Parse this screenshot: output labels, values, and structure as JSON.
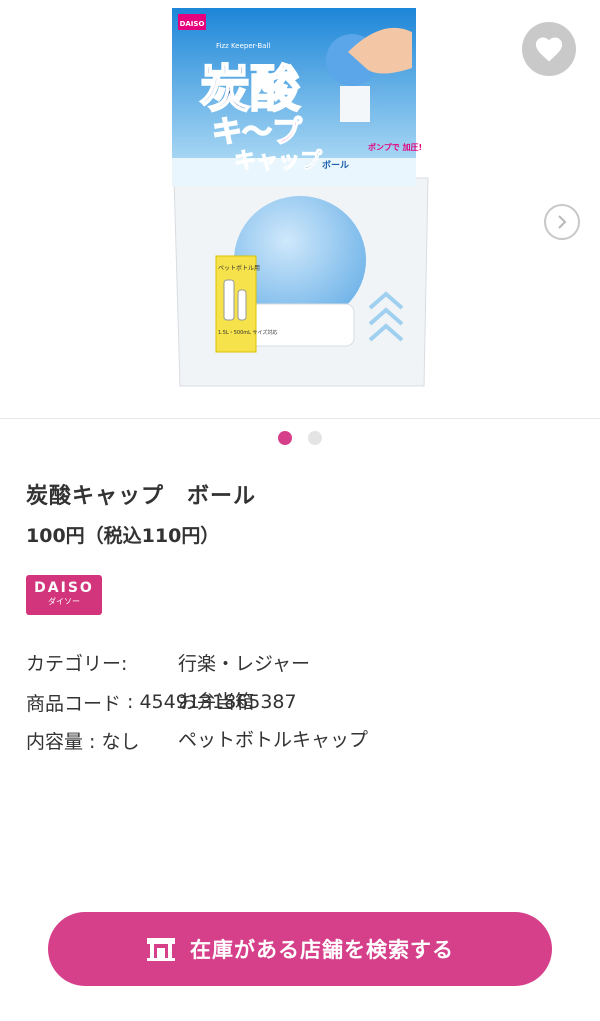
{
  "gallery": {
    "pack_text": {
      "brand": "DAISO",
      "subtitle": "Fizz Keeper-Ball",
      "line1": "炭酸",
      "line2": "キ〜プ",
      "line3": "キャップ",
      "ball_tag": "ボール",
      "pump_text": "ポンプで 加圧!",
      "bottle_tag": "ペットボトル用",
      "size_text": "1.5L・500mL サイズ対応"
    },
    "page_count": 2,
    "active_index": 0
  },
  "product": {
    "title": "炭酸キャップ　ボール",
    "price": "100円（税込110円）",
    "brand_badge": "DAISO",
    "brand_badge_sub": "ダイソー"
  },
  "details": {
    "category_label": "カテゴリー:",
    "categories": [
      "行楽・レジャー",
      "お弁当箱",
      "ペットボトルキャップ"
    ],
    "code_label": "商品コード",
    "code_value": ": 4549131865387",
    "content_label": "内容量",
    "content_value": ": なし"
  },
  "actions": {
    "store_search": "在庫がある店舗を検索する"
  },
  "colors": {
    "accent": "#d6408a",
    "badge": "#d2357b",
    "dot_inactive": "#e4e4e4"
  }
}
